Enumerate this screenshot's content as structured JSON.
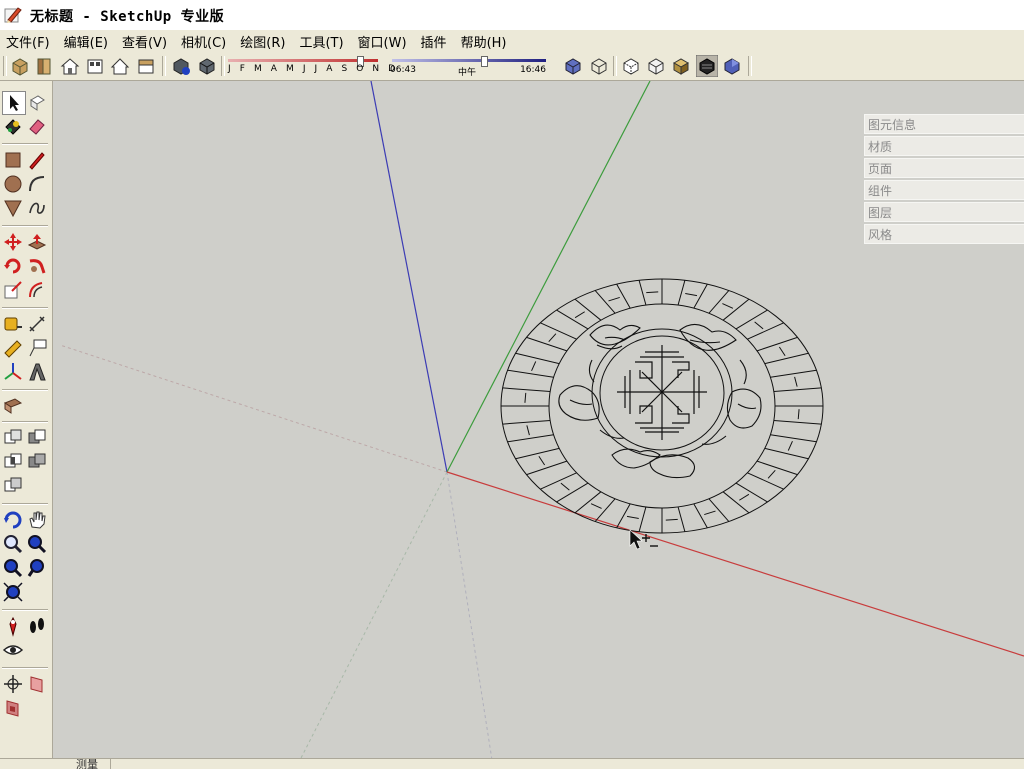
{
  "window": {
    "title": "无标题 - SketchUp 专业版",
    "icon": "sketchup-pencil-icon"
  },
  "menu": [
    {
      "label": "文件(F)"
    },
    {
      "label": "编辑(E)"
    },
    {
      "label": "查看(V)"
    },
    {
      "label": "相机(C)"
    },
    {
      "label": "绘图(R)"
    },
    {
      "label": "工具(T)"
    },
    {
      "label": "窗口(W)"
    },
    {
      "label": "插件"
    },
    {
      "label": "帮助(H)"
    }
  ],
  "shadow": {
    "months": "J F M A M J J A S O N D",
    "month_position": 0.86,
    "time_start": "06:43",
    "time_noon": "中午",
    "time_end": "16:46",
    "time_position": 0.58
  },
  "tray": [
    {
      "label": "图元信息"
    },
    {
      "label": "材质"
    },
    {
      "label": "页面"
    },
    {
      "label": "组件"
    },
    {
      "label": "图层"
    },
    {
      "label": "风格"
    }
  ],
  "status": {
    "text": "测量"
  },
  "colors": {
    "axis_red": "#c83c3c",
    "axis_green": "#3c9c3c",
    "axis_blue": "#3c3cb4",
    "viewport_bg": "#cfcfca"
  }
}
